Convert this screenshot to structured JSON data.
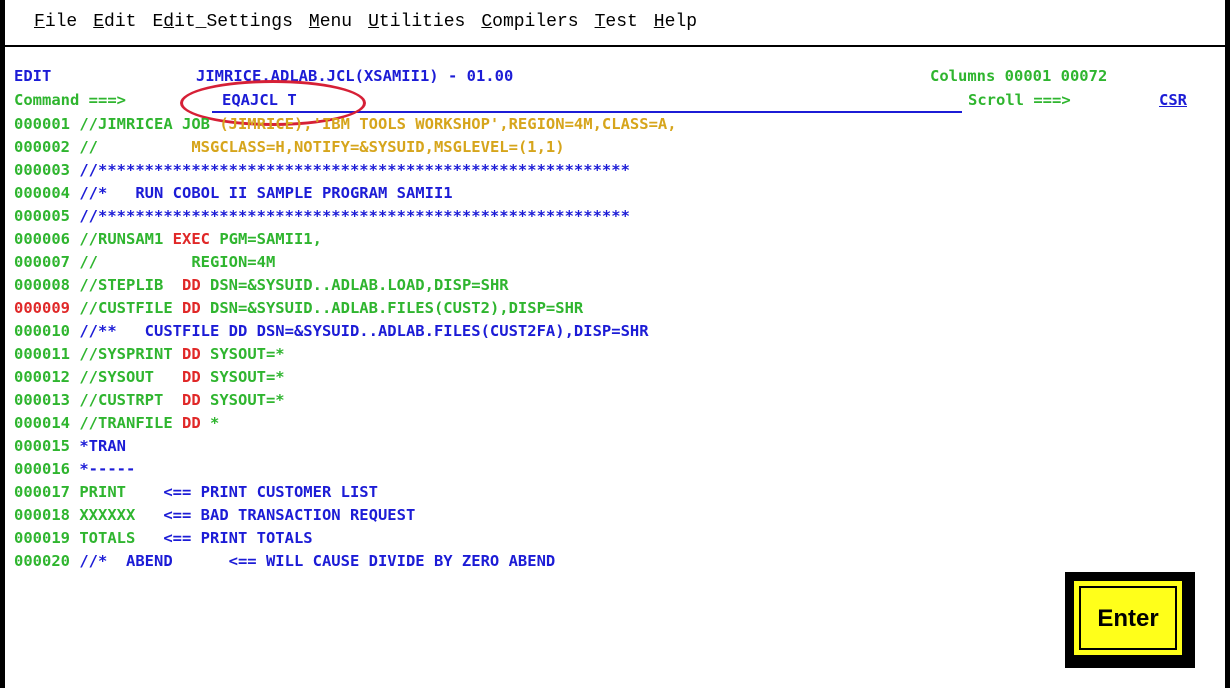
{
  "menu": [
    {
      "label": "File"
    },
    {
      "label": "Edit"
    },
    {
      "label": "Edit_Settings"
    },
    {
      "label": "Menu"
    },
    {
      "label": "Utilities"
    },
    {
      "label": "Compilers"
    },
    {
      "label": "Test"
    },
    {
      "label": "Help"
    }
  ],
  "header": {
    "mode": "EDIT",
    "dataset": "JIMRICE.ADLAB.JCL(XSAMII1) - 01.00",
    "columns": "Columns 00001 00072"
  },
  "command": {
    "label": "Command ===>",
    "value": "EQAJCL T",
    "scroll_label": "Scroll ===>",
    "scroll_value": "CSR"
  },
  "lines": [
    {
      "seq": "000001",
      "text": " //JIMRICEA JOB (JIMRICE),'IBM TOOLS WORKSHOP',REGION=4M,CLASS=A,"
    },
    {
      "seq": "000002",
      "text": " //          MSGCLASS=H,NOTIFY=&SYSUID,MSGLEVEL=(1,1)"
    },
    {
      "seq": "000003",
      "text": " //*********************************************************"
    },
    {
      "seq": "000004",
      "text": " //*   RUN COBOL II SAMPLE PROGRAM SAMII1"
    },
    {
      "seq": "000005",
      "text": " //*********************************************************"
    },
    {
      "seq": "000006",
      "text": " //RUNSAM1 EXEC PGM=SAMII1,"
    },
    {
      "seq": "000007",
      "text": " //          REGION=4M"
    },
    {
      "seq": "000008",
      "text": " //STEPLIB  DD DSN=&SYSUID..ADLAB.LOAD,DISP=SHR"
    },
    {
      "seq": "000009",
      "text": " //CUSTFILE DD DSN=&SYSUID..ADLAB.FILES(CUST2),DISP=SHR"
    },
    {
      "seq": "000010",
      "text": " //**   CUSTFILE DD DSN=&SYSUID..ADLAB.FILES(CUST2FA),DISP=SHR"
    },
    {
      "seq": "000011",
      "text": " //SYSPRINT DD SYSOUT=*"
    },
    {
      "seq": "000012",
      "text": " //SYSOUT   DD SYSOUT=*"
    },
    {
      "seq": "000013",
      "text": " //CUSTRPT  DD SYSOUT=*"
    },
    {
      "seq": "000014",
      "text": " //TRANFILE DD *"
    },
    {
      "seq": "000015",
      "text": " *TRAN"
    },
    {
      "seq": "000016",
      "text": " *-----"
    },
    {
      "seq": "000017",
      "text": " PRINT    <== PRINT CUSTOMER LIST"
    },
    {
      "seq": "000018",
      "text": " XXXXXX   <== BAD TRANSACTION REQUEST"
    },
    {
      "seq": "000019",
      "text": " TOTALS   <== PRINT TOTALS"
    },
    {
      "seq": "000020",
      "text": " //*  ABEND      <== WILL CAUSE DIVIDE BY ZERO ABEND"
    }
  ],
  "enter_button": {
    "label": "Enter"
  },
  "colors": {
    "green": "#2fb52f",
    "blue": "#1c1cd6",
    "red": "#e02828",
    "yellow": "#d6a51c",
    "callout": "#d62036",
    "button": "#ffff1a"
  }
}
